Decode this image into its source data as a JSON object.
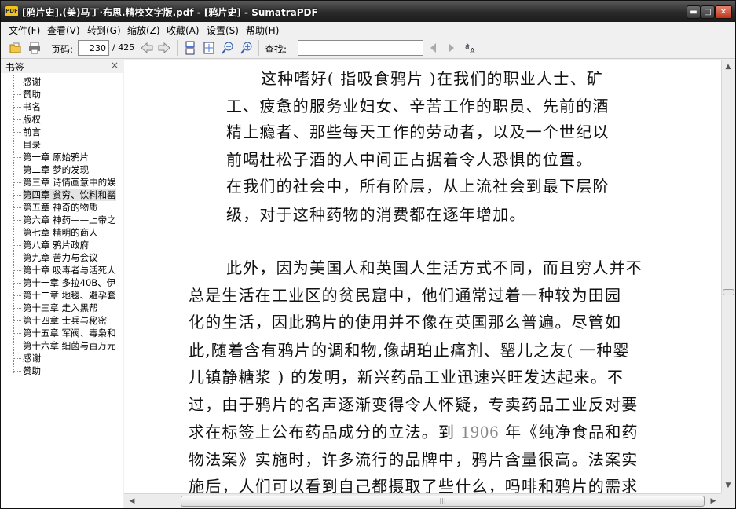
{
  "window": {
    "title": "[鸦片史].(美)马丁·布思.精校文字版.pdf - [鸦片史] - SumatraPDF",
    "app_icon_text": "PDF",
    "min_glyph": "▬",
    "max_glyph": "□",
    "close_glyph": "✕"
  },
  "menu": [
    "文件(F)",
    "查看(V)",
    "转到(G)",
    "缩放(Z)",
    "收藏(A)",
    "设置(S)",
    "帮助(H)"
  ],
  "toolbar": {
    "page_label": "页码:",
    "page_value": "230",
    "page_total": "/ 425",
    "find_label": "查找:",
    "find_value": ""
  },
  "sidebar": {
    "title": "书签",
    "close_glyph": "×",
    "selected_index": 9,
    "items": [
      "感谢",
      "赞助",
      "书名",
      "版权",
      "前言",
      "目录",
      "第一章 原始鸦片",
      "第二章 梦的发现",
      "第三章 诗情画意中的娱",
      "第四章 贫穷、饮料和罂",
      "第五章 神奇的物质",
      "第六章 神药——上帝之",
      "第七章 精明的商人",
      "第八章 鸦片政府",
      "第九章 苦力与会议",
      "第十章 吸毒者与活死人",
      "第十一章 多拉40B、伊",
      "第十二章 地毯、避孕套",
      "第十三章 走入黑帮",
      "第十四章 士兵与秘密",
      "第十五章 军阀、毒枭和",
      "第十六章 细菌与百万元",
      "感谢",
      "赞助"
    ]
  },
  "document": {
    "lines": [
      "这种嗜好( 指吸食鸦片 )在我们的职业人士、矿",
      "工、疲惫的服务业妇女、辛苦工作的职员、先前的酒",
      "精上瘾者、那些每天工作的劳动者，以及一个世纪以",
      "前喝杜松子酒的人中间正占据着令人恐惧的位置。",
      "在我们的社会中，所有阶层，从上流社会到最下层阶",
      "级，对于这种药物的消费都在逐年增加。",
      "此外，因为美国人和英国人生活方式不同，而且穷人并不",
      "总是生活在工业区的贫民窟中，他们通常过着一种较为田园",
      "化的生活，因此鸦片的使用并不像在英国那么普遍。尽管如",
      "此,随着含有鸦片的调和物,像胡珀止痛剂、罂儿之友( 一种婴",
      "儿镇静糖浆 ) 的发明，新兴药品工业迅速兴旺发达起来。不",
      "过，由于鸦片的名声逐渐变得令人怀疑，专卖药品工业反对要",
      "物法案》实施时，许多流行的品牌中，鸦片含量很高。法案实",
      "施后，人们可以看到自己都摄取了些什么，吗啡和鸦片的需求"
    ],
    "line_with_year": {
      "before": "求在标签上公布药品成分的立法。到 ",
      "year": "1906",
      "after": " 年《纯净食品和药"
    }
  },
  "scrollbars": {
    "up": "▲",
    "down": "▼",
    "left": "◀",
    "right": "▶",
    "grip": "|||"
  }
}
